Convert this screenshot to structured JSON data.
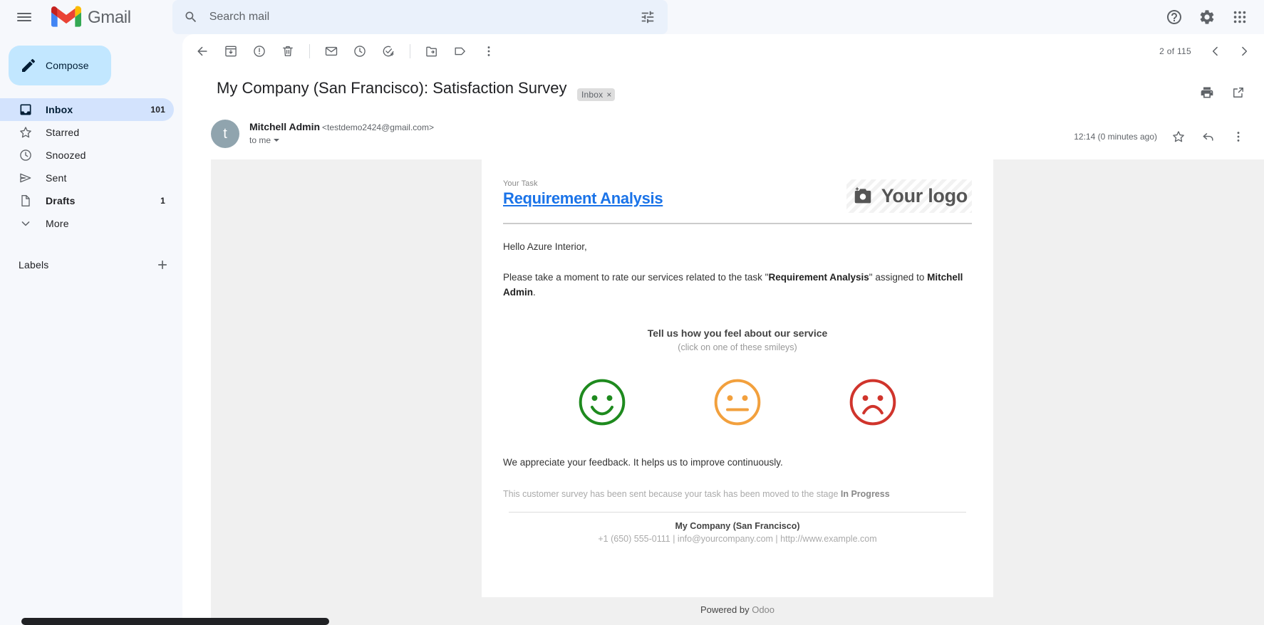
{
  "topbar": {
    "menu_icon": "hamburger-icon",
    "brand": "Gmail",
    "search": {
      "placeholder": "Search mail",
      "value": "",
      "search_icon": "search-icon",
      "filter_icon": "tune-filter-icon"
    },
    "help_icon": "help-circle-icon",
    "settings_icon": "gear-icon",
    "apps_icon": "apps-grid-icon"
  },
  "sidebar": {
    "compose": {
      "label": "Compose",
      "icon": "pencil-icon"
    },
    "items": [
      {
        "label": "Inbox",
        "count": "101",
        "icon": "inbox-icon",
        "active": true
      },
      {
        "label": "Starred",
        "count": "",
        "icon": "star-icon",
        "active": false
      },
      {
        "label": "Snoozed",
        "count": "",
        "icon": "clock-icon",
        "active": false
      },
      {
        "label": "Sent",
        "count": "",
        "icon": "send-icon",
        "active": false
      },
      {
        "label": "Drafts",
        "count": "1",
        "icon": "draft-icon",
        "active": false
      },
      {
        "label": "More",
        "count": "",
        "icon": "chevron-down-icon",
        "active": false
      }
    ],
    "labels": {
      "title": "Labels",
      "add_icon": "plus-icon"
    }
  },
  "toolbar": {
    "back_icon": "arrow-back-icon",
    "archive_icon": "archive-icon",
    "spam_icon": "report-spam-icon",
    "delete_icon": "trash-icon",
    "unread_icon": "mark-unread-icon",
    "snooze_icon": "clock-snooze-icon",
    "tasks_icon": "add-to-tasks-icon",
    "move_icon": "move-to-folder-icon",
    "label_icon": "label-tag-icon",
    "more_icon": "more-vertical-icon",
    "page_count": "2 of 115",
    "prev_icon": "chevron-left-icon",
    "next_icon": "chevron-right-icon"
  },
  "message": {
    "subject": "My Company (San Francisco): Satisfaction Survey",
    "label_chip": "Inbox",
    "label_chip_close": "×",
    "print_icon": "print-icon",
    "popout_icon": "open-in-new-icon",
    "avatar_letter": "t",
    "sender_name": "Mitchell Admin",
    "sender_email": "<testdemo2424@gmail.com>",
    "recipient": "to me",
    "timestamp": "12:14 (0 minutes ago)",
    "star_icon": "star-outline-icon",
    "reply_icon": "reply-arrow-icon",
    "more_icon": "more-vertical-icon"
  },
  "email_content": {
    "eyebrow": "Your Task",
    "task_title": "Requirement Analysis",
    "logo_placeholder": "Your logo",
    "logo_icon": "camera-icon",
    "greeting": "Hello Azure Interior,",
    "intro_prefix": "Please take a moment to rate our services related to the task \"",
    "intro_task": "Requirement Analysis",
    "intro_mid": "\" assigned to ",
    "intro_person": "Mitchell Admin",
    "intro_suffix": ".",
    "feel_title": "Tell us how you feel about our service",
    "feel_sub": "(click on one of these smileys)",
    "smileys": [
      {
        "name": "happy-smiley",
        "color": "#1e8a1e"
      },
      {
        "name": "neutral-smiley",
        "color": "#f2a03d"
      },
      {
        "name": "sad-smiley",
        "color": "#d0342c"
      }
    ],
    "thanks": "We appreciate your feedback. It helps us to improve continuously.",
    "note_prefix": "This customer survey has been sent because your task has been moved to the stage ",
    "note_stage": "In Progress",
    "company": "My Company (San Francisco)",
    "contact": "+1 (650) 555-0111 | info@yourcompany.com | http://www.example.com",
    "powered_prefix": "Powered by ",
    "powered_brand": "Odoo"
  },
  "colors": {
    "accent_blue": "#1a73e8",
    "compose_bg": "#c2e7ff",
    "active_nav": "#d3e3fd",
    "page_bg": "#f6f8fc"
  }
}
